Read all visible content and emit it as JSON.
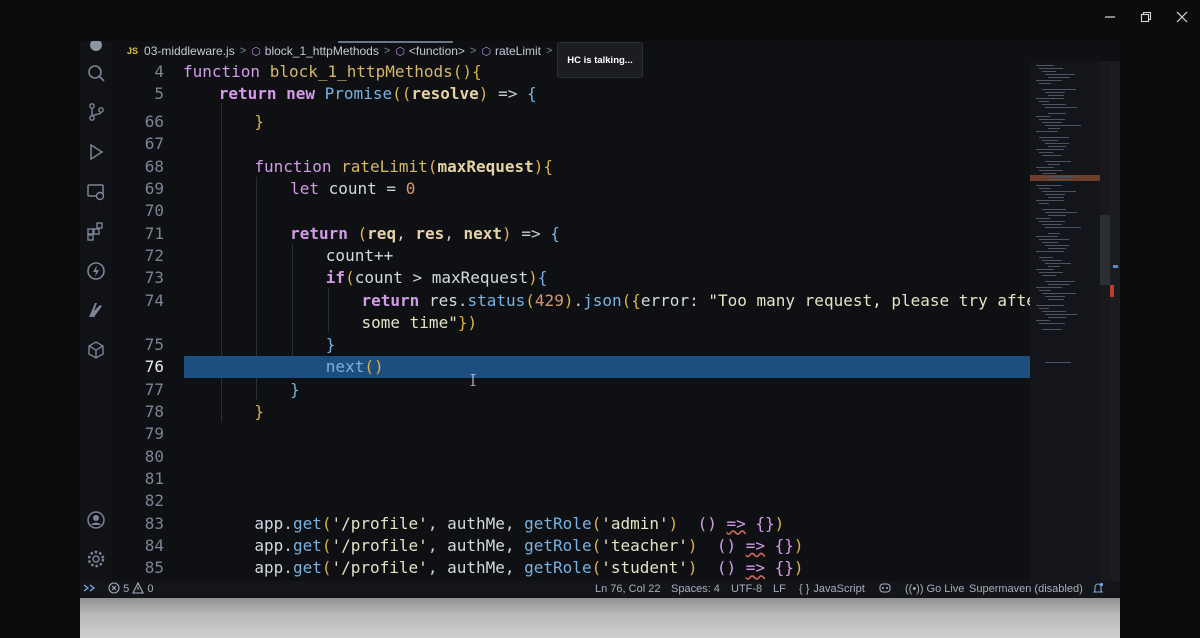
{
  "window": {
    "minimize_icon": "minimize-icon",
    "restore_icon": "restore-icon",
    "close_icon": "close-icon"
  },
  "breadcrumb": {
    "file_badge": "JS",
    "file": "03-middleware.js",
    "items": [
      "block_1_httpMethods",
      "<function>",
      "rateLimit",
      "<"
    ]
  },
  "tooltip": "HC is talking...",
  "code": {
    "lines": [
      {
        "n": "4",
        "row": 0,
        "indent": 0,
        "parts": [
          [
            "kw",
            "function "
          ],
          [
            "fn",
            "block_1_httpMethods"
          ],
          [
            "br",
            "(){"
          ]
        ]
      },
      {
        "n": "5",
        "row": 1,
        "indent": 1,
        "parts": [
          [
            "kwb",
            "return "
          ],
          [
            "kwb",
            "new "
          ],
          [
            "meth",
            "Promise"
          ],
          [
            "br",
            "(("
          ],
          [
            "pm",
            "resolve"
          ],
          [
            "br",
            ")"
          ],
          [
            "op",
            " => "
          ],
          [
            "meth",
            "{"
          ]
        ]
      },
      {
        "n": "66",
        "row": 2.25,
        "indent": 2,
        "parts": [
          [
            "br",
            "}"
          ]
        ]
      },
      {
        "n": "67",
        "row": 3.25,
        "indent": 0,
        "parts": []
      },
      {
        "n": "68",
        "row": 4.25,
        "indent": 2,
        "parts": [
          [
            "kw",
            "function "
          ],
          [
            "fn",
            "rateLimit"
          ],
          [
            "br",
            "("
          ],
          [
            "pm",
            "maxRequest"
          ],
          [
            "br",
            "){"
          ]
        ]
      },
      {
        "n": "69",
        "row": 5.25,
        "indent": 3,
        "parts": [
          [
            "kw",
            "let "
          ],
          [
            "pl",
            "count "
          ],
          [
            "op",
            "= "
          ],
          [
            "num",
            "0"
          ]
        ]
      },
      {
        "n": "70",
        "row": 6.25,
        "indent": 0,
        "parts": []
      },
      {
        "n": "71",
        "row": 7.25,
        "indent": 3,
        "parts": [
          [
            "kwb",
            "return "
          ],
          [
            "br",
            "("
          ],
          [
            "pm",
            "req"
          ],
          [
            "op",
            ", "
          ],
          [
            "pm",
            "res"
          ],
          [
            "op",
            ", "
          ],
          [
            "pm",
            "next"
          ],
          [
            "br",
            ")"
          ],
          [
            "op",
            " => "
          ],
          [
            "meth",
            "{"
          ]
        ]
      },
      {
        "n": "72",
        "row": 8.25,
        "indent": 4,
        "parts": [
          [
            "pl",
            "count++"
          ]
        ]
      },
      {
        "n": "73",
        "row": 9.25,
        "indent": 4,
        "parts": [
          [
            "kwb",
            "if"
          ],
          [
            "br",
            "("
          ],
          [
            "pl",
            "count "
          ],
          [
            "op",
            "> "
          ],
          [
            "pl",
            "maxRequest"
          ],
          [
            "br",
            ")"
          ],
          [
            "meth",
            "{"
          ]
        ]
      },
      {
        "n": "74",
        "row": 10.25,
        "indent": 5,
        "parts": [
          [
            "kwb",
            "return "
          ],
          [
            "pl",
            "res"
          ],
          [
            "op",
            "."
          ],
          [
            "meth",
            "status"
          ],
          [
            "br",
            "("
          ],
          [
            "num",
            "429"
          ],
          [
            "br",
            ")"
          ],
          [
            "op",
            "."
          ],
          [
            "meth",
            "json"
          ],
          [
            "br",
            "({"
          ],
          [
            "pl",
            "error"
          ],
          [
            "op",
            ": "
          ],
          [
            "str",
            "\"Too many request, please try after"
          ]
        ]
      },
      {
        "n": "",
        "row": 11.25,
        "indent": 5,
        "parts": [
          [
            "str",
            "some time\""
          ],
          [
            "br",
            "})"
          ]
        ]
      },
      {
        "n": "75",
        "row": 12.25,
        "indent": 4,
        "parts": [
          [
            "meth",
            "}"
          ]
        ]
      },
      {
        "n": "76",
        "row": 13.25,
        "indent": 4,
        "current": true,
        "parts": [
          [
            "meth",
            "next"
          ],
          [
            "br",
            "()"
          ]
        ]
      },
      {
        "n": "77",
        "row": 14.25,
        "indent": 3,
        "parts": [
          [
            "meth",
            "}"
          ]
        ]
      },
      {
        "n": "78",
        "row": 15.25,
        "indent": 2,
        "parts": [
          [
            "br",
            "}"
          ]
        ]
      },
      {
        "n": "79",
        "row": 16.25,
        "indent": 0,
        "parts": []
      },
      {
        "n": "80",
        "row": 17.25,
        "indent": 0,
        "parts": []
      },
      {
        "n": "81",
        "row": 18.25,
        "indent": 0,
        "parts": []
      },
      {
        "n": "82",
        "row": 19.25,
        "indent": 0,
        "parts": []
      },
      {
        "n": "83",
        "row": 20.25,
        "indent": 2,
        "parts": [
          [
            "pl",
            "app"
          ],
          [
            "op",
            "."
          ],
          [
            "meth",
            "get"
          ],
          [
            "br",
            "("
          ],
          [
            "str",
            "'/profile'"
          ],
          [
            "op",
            ", "
          ],
          [
            "pl",
            "authMe"
          ],
          [
            "op",
            ", "
          ],
          [
            "meth",
            "getRole"
          ],
          [
            "br",
            "("
          ],
          [
            "str",
            "'admin'"
          ],
          [
            "br",
            ")"
          ],
          [
            "op",
            "  "
          ],
          [
            "kw",
            "()"
          ],
          [
            "op",
            " "
          ],
          [
            "kwsq",
            "=>"
          ],
          [
            "op",
            " "
          ],
          [
            "kw",
            "{}"
          ],
          [
            "br",
            ")"
          ]
        ]
      },
      {
        "n": "84",
        "row": 21.25,
        "indent": 2,
        "parts": [
          [
            "pl",
            "app"
          ],
          [
            "op",
            "."
          ],
          [
            "meth",
            "get"
          ],
          [
            "br",
            "("
          ],
          [
            "str",
            "'/profile'"
          ],
          [
            "op",
            ", "
          ],
          [
            "pl",
            "authMe"
          ],
          [
            "op",
            ", "
          ],
          [
            "meth",
            "getRole"
          ],
          [
            "br",
            "("
          ],
          [
            "str",
            "'teacher'"
          ],
          [
            "br",
            ")"
          ],
          [
            "op",
            "  "
          ],
          [
            "kw",
            "()"
          ],
          [
            "op",
            " "
          ],
          [
            "kwsq",
            "=>"
          ],
          [
            "op",
            " "
          ],
          [
            "kw",
            "{}"
          ],
          [
            "br",
            ")"
          ]
        ]
      },
      {
        "n": "85",
        "row": 22.25,
        "indent": 2,
        "parts": [
          [
            "pl",
            "app"
          ],
          [
            "op",
            "."
          ],
          [
            "meth",
            "get"
          ],
          [
            "br",
            "("
          ],
          [
            "str",
            "'/profile'"
          ],
          [
            "op",
            ", "
          ],
          [
            "pl",
            "authMe"
          ],
          [
            "op",
            ", "
          ],
          [
            "meth",
            "getRole"
          ],
          [
            "br",
            "("
          ],
          [
            "str",
            "'student'"
          ],
          [
            "br",
            ")"
          ],
          [
            "op",
            "  "
          ],
          [
            "kw",
            "()"
          ],
          [
            "op",
            " "
          ],
          [
            "kwsq",
            "=>"
          ],
          [
            "op",
            " "
          ],
          [
            "kw",
            "{}"
          ],
          [
            "br",
            ")"
          ]
        ]
      }
    ]
  },
  "status": {
    "errors": "5",
    "warnings": "0",
    "position": "Ln 76, Col 22",
    "spaces": "Spaces: 4",
    "encoding": "UTF-8",
    "eol": "LF",
    "language": "JavaScript",
    "go_live": "Go Live",
    "supermaven": "Supermaven (disabled)"
  }
}
